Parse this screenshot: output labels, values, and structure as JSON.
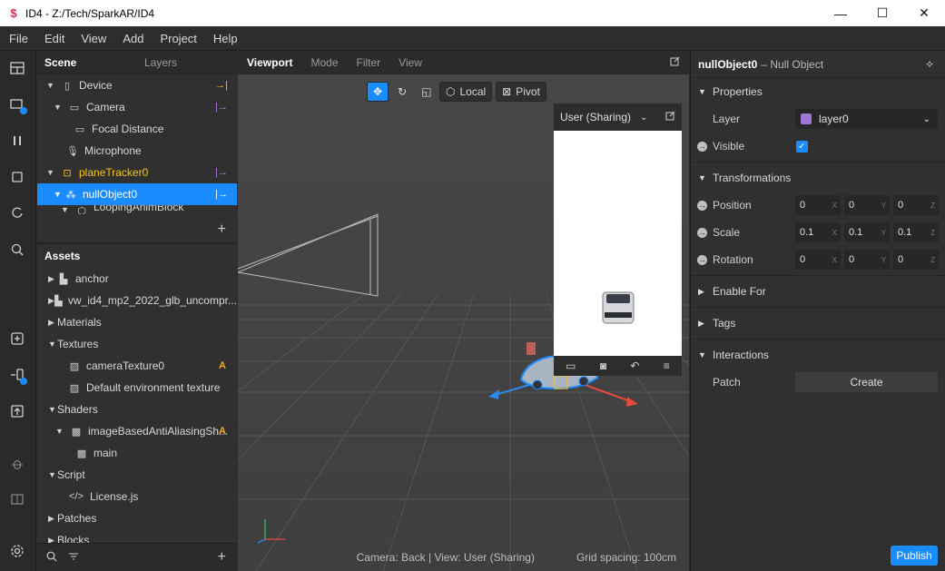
{
  "window": {
    "title": "ID4 - Z:/Tech/SparkAR/ID4",
    "minimize": "—",
    "maximize": "☐",
    "close": "✕"
  },
  "menu": [
    "File",
    "Edit",
    "View",
    "Add",
    "Project",
    "Help"
  ],
  "scene_panel": {
    "tabs": [
      "Scene",
      "Layers"
    ],
    "items": [
      {
        "label": "Device",
        "icon": "phone-icon"
      },
      {
        "label": "Camera",
        "icon": "camera-icon"
      },
      {
        "label": "Focal Distance",
        "icon": "ruler-icon"
      },
      {
        "label": "Microphone",
        "icon": "microphone-icon"
      },
      {
        "label": "planeTracker0",
        "icon": "plane-tracker-icon"
      },
      {
        "label": "nullObject0",
        "icon": "null-object-icon"
      },
      {
        "label": "LoopingAnimBlock",
        "icon": "block-icon"
      }
    ],
    "add": "+"
  },
  "assets_panel": {
    "header": "Assets",
    "items": [
      {
        "label": "anchor",
        "icon": "file-icon"
      },
      {
        "label": "vw_id4_mp2_2022_glb_uncompr...",
        "icon": "file-icon"
      },
      {
        "label": "Materials",
        "icon": ""
      },
      {
        "label": "Textures",
        "icon": ""
      },
      {
        "label": "cameraTexture0",
        "icon": "texture-icon",
        "badge": "A"
      },
      {
        "label": "Default environment texture",
        "icon": "env-texture-icon"
      },
      {
        "label": "Shaders",
        "icon": ""
      },
      {
        "label": "imageBasedAntiAliasingSh...",
        "icon": "shader-icon",
        "badge": "A"
      },
      {
        "label": "main",
        "icon": "shader-icon"
      },
      {
        "label": "Script",
        "icon": ""
      },
      {
        "label": "License.js",
        "icon": "code-icon"
      },
      {
        "label": "Patches",
        "icon": ""
      },
      {
        "label": "Blocks",
        "icon": ""
      }
    ],
    "add": "+"
  },
  "viewport": {
    "tabs": [
      "Viewport",
      "Mode",
      "Filter",
      "View"
    ],
    "local_label": "Local",
    "pivot_label": "Pivot",
    "preview_dropdown": "User (Sharing)",
    "status_camera": "Camera: Back | View: User (Sharing)",
    "status_grid": "Grid spacing: 100cm"
  },
  "inspector": {
    "object_name": "nullObject0",
    "object_type": "– Null Object",
    "properties_label": "Properties",
    "layer_label": "Layer",
    "layer_value": "layer0",
    "visible_label": "Visible",
    "transformations_label": "Transformations",
    "position_label": "Position",
    "position": [
      "0",
      "0",
      "0"
    ],
    "scale_label": "Scale",
    "scale": [
      "0.1",
      "0.1",
      "0.1"
    ],
    "rotation_label": "Rotation",
    "rotation": [
      "0",
      "0",
      "0"
    ],
    "axes": [
      "X",
      "Y",
      "Z"
    ],
    "enable_for_label": "Enable For",
    "tags_label": "Tags",
    "interactions_label": "Interactions",
    "patch_label": "Patch",
    "create_label": "Create",
    "publish_label": "Publish"
  },
  "colors": {
    "accent": "#1a8cff",
    "tracker_yellow": "#f5c518",
    "link_purple": "#b77ce8",
    "layer_swatch": "#a276d6"
  }
}
